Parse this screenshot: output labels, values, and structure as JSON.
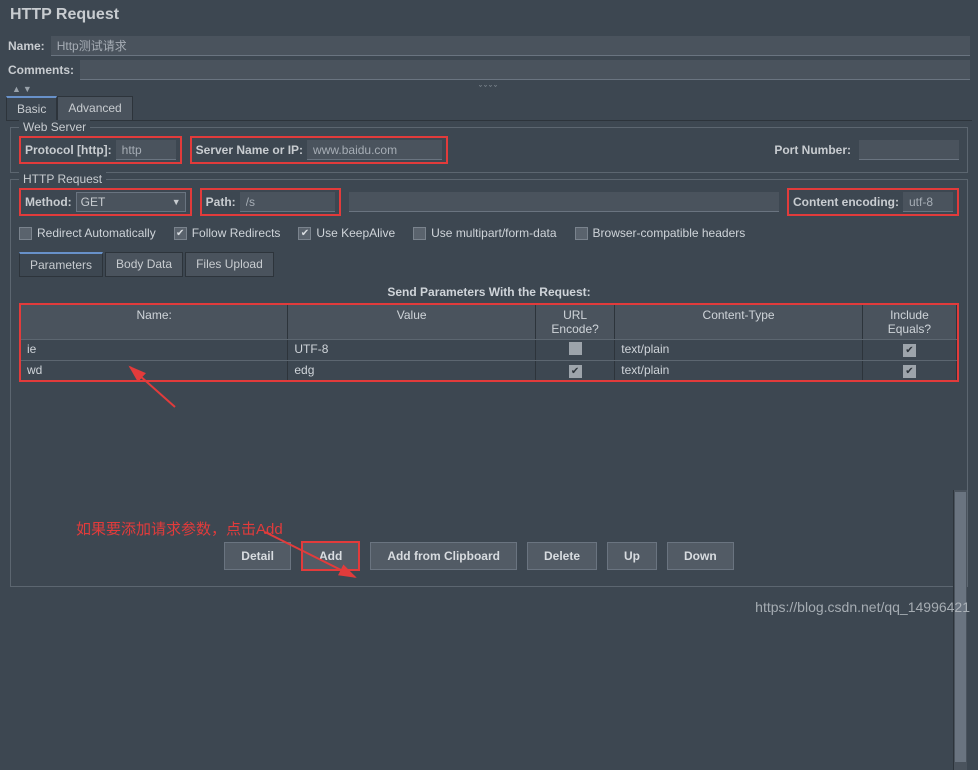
{
  "title": "HTTP Request",
  "name_label": "Name:",
  "name_value": "Http测试请求",
  "comments_label": "Comments:",
  "tabs": {
    "basic": "Basic",
    "advanced": "Advanced"
  },
  "web_server": {
    "legend": "Web Server",
    "protocol_label": "Protocol [http]:",
    "protocol_value": "http",
    "server_label": "Server Name or IP:",
    "server_value": "www.baidu.com",
    "port_label": "Port Number:",
    "port_value": ""
  },
  "http_request": {
    "legend": "HTTP Request",
    "method_label": "Method:",
    "method_value": "GET",
    "path_label": "Path:",
    "path_value": "/s",
    "encoding_label": "Content encoding:",
    "encoding_value": "utf-8"
  },
  "checks": {
    "redirect_auto": "Redirect Automatically",
    "follow_redirects": "Follow Redirects",
    "keepalive": "Use KeepAlive",
    "multipart": "Use multipart/form-data",
    "browser_compat": "Browser-compatible headers"
  },
  "sub_tabs": {
    "params": "Parameters",
    "body": "Body Data",
    "files": "Files Upload"
  },
  "grid": {
    "title": "Send Parameters With the Request:",
    "headers": {
      "name": "Name:",
      "value": "Value",
      "encode": "URL Encode?",
      "ctype": "Content-Type",
      "include": "Include Equals?"
    },
    "rows": [
      {
        "name": "ie",
        "value": "UTF-8",
        "encode": false,
        "ctype": "text/plain",
        "include": true
      },
      {
        "name": "wd",
        "value": "edg",
        "encode": true,
        "ctype": "text/plain",
        "include": true
      }
    ]
  },
  "annotation": "如果要添加请求参数，点击Add",
  "buttons": {
    "detail": "Detail",
    "add": "Add",
    "clipboard": "Add from Clipboard",
    "delete": "Delete",
    "up": "Up",
    "down": "Down"
  },
  "watermark": "https://blog.csdn.net/qq_14996421"
}
